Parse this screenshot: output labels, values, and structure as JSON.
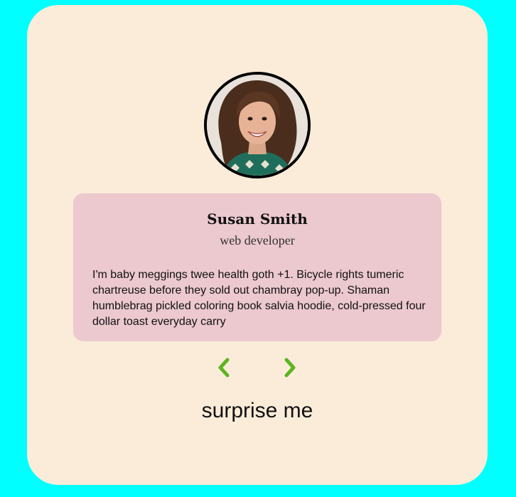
{
  "person": {
    "name": "Susan Smith",
    "job": "web developer",
    "bio": "I'm baby meggings twee health goth +1. Bicycle rights tumeric chartreuse before they sold out chambray pop-up. Shaman humblebrag pickled coloring book salvia hoodie, cold-pressed four dollar toast everyday carry"
  },
  "controls": {
    "prev_icon": "chevron-left-icon",
    "next_icon": "chevron-right-icon",
    "surprise_label": "surprise me"
  },
  "colors": {
    "page_background": "#00ffff",
    "card_background": "#faecd8",
    "info_background": "#ecc8cf",
    "accent": "#5bb520"
  }
}
